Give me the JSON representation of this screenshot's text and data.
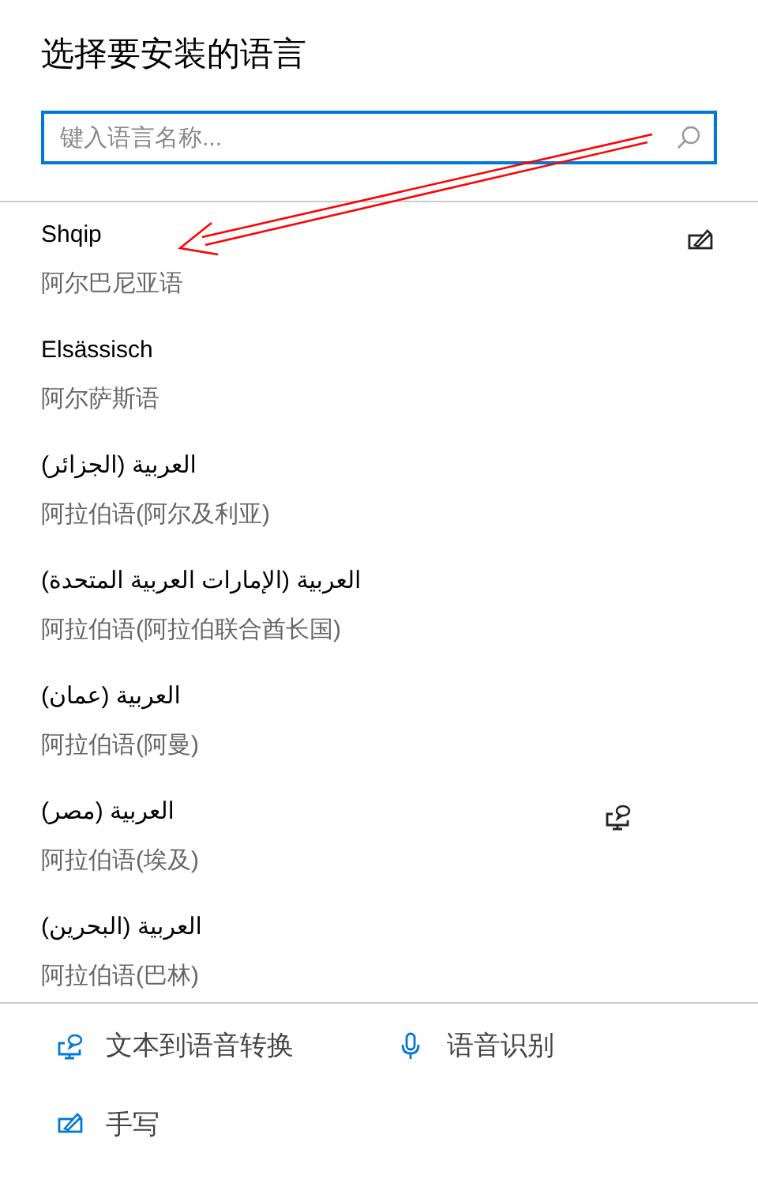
{
  "title": "选择要安装的语言",
  "search": {
    "placeholder": "键入语言名称..."
  },
  "languages": [
    {
      "native": "Shqip",
      "name": "阿尔巴尼亚语",
      "features": [
        {
          "kind": "handwriting"
        }
      ]
    },
    {
      "native": "Elsässisch",
      "name": "阿尔萨斯语"
    },
    {
      "native": "العربية (الجزائر)",
      "name": "阿拉伯语(阿尔及利亚)"
    },
    {
      "native": "العربية (الإمارات العربية المتحدة)",
      "name": "阿拉伯语(阿拉伯联合酋长国)"
    },
    {
      "native": "العربية (عمان)",
      "name": "阿拉伯语(阿曼)"
    },
    {
      "native": "العربية (مصر)",
      "name": "阿拉伯语(埃及)",
      "features": [
        {
          "kind": "speech"
        }
      ]
    },
    {
      "native": "العربية (البحرين)",
      "name": "阿拉伯语(巴林)"
    }
  ],
  "legend": [
    {
      "kind": "speech",
      "label": "文本到语音转换"
    },
    {
      "kind": "recognition",
      "label": "语音识别"
    },
    {
      "kind": "handwriting",
      "label": "手写"
    }
  ],
  "annotation": {
    "kind": "arrow"
  }
}
